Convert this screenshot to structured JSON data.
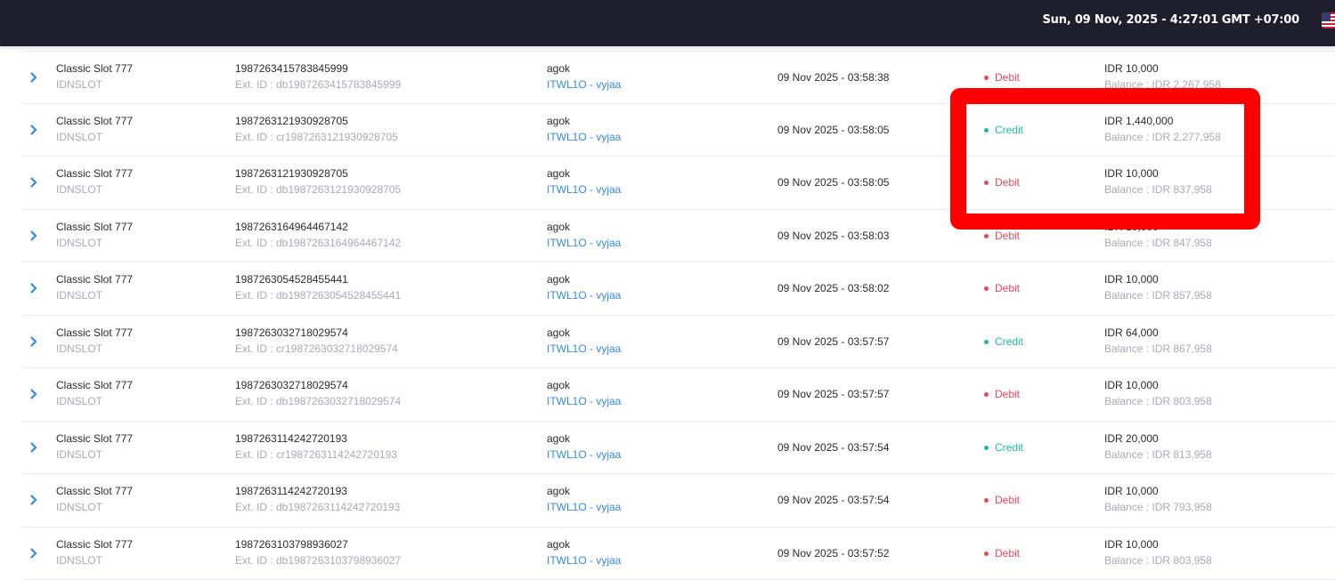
{
  "header": {
    "datetime": "Sun, 09 Nov, 2025 - 4:27:01",
    "timezone": "GMT +07:00",
    "language_flag_icon": "us-flag-icon"
  },
  "rows": [
    {
      "game": "Classic Slot 777",
      "provider": "IDNSLOT",
      "txid": "1987263415783845999",
      "extid": "Ext. ID : db1987263415783845999",
      "user": "agok",
      "agent": "ITWL1O - vyjaa",
      "date": "09 Nov 2025 - 03:58:38",
      "type": "Debit",
      "amount": "IDR 10,000",
      "balance": "Balance : IDR 2,267,958"
    },
    {
      "game": "Classic Slot 777",
      "provider": "IDNSLOT",
      "txid": "1987263121930928705",
      "extid": "Ext. ID : cr1987263121930928705",
      "user": "agok",
      "agent": "ITWL1O - vyjaa",
      "date": "09 Nov 2025 - 03:58:05",
      "type": "Credit",
      "amount": "IDR 1,440,000",
      "balance": "Balance : IDR 2,277,958"
    },
    {
      "game": "Classic Slot 777",
      "provider": "IDNSLOT",
      "txid": "1987263121930928705",
      "extid": "Ext. ID : db1987263121930928705",
      "user": "agok",
      "agent": "ITWL1O - vyjaa",
      "date": "09 Nov 2025 - 03:58:05",
      "type": "Debit",
      "amount": "IDR 10,000",
      "balance": "Balance : IDR 837,958"
    },
    {
      "game": "Classic Slot 777",
      "provider": "IDNSLOT",
      "txid": "1987263164964467142",
      "extid": "Ext. ID : db1987263164964467142",
      "user": "agok",
      "agent": "ITWL1O - vyjaa",
      "date": "09 Nov 2025 - 03:58:03",
      "type": "Debit",
      "amount": "IDR 10,000",
      "balance": "Balance : IDR 847,958"
    },
    {
      "game": "Classic Slot 777",
      "provider": "IDNSLOT",
      "txid": "1987263054528455441",
      "extid": "Ext. ID : db1987263054528455441",
      "user": "agok",
      "agent": "ITWL1O - vyjaa",
      "date": "09 Nov 2025 - 03:58:02",
      "type": "Debit",
      "amount": "IDR 10,000",
      "balance": "Balance : IDR 857,958"
    },
    {
      "game": "Classic Slot 777",
      "provider": "IDNSLOT",
      "txid": "1987263032718029574",
      "extid": "Ext. ID : cr1987263032718029574",
      "user": "agok",
      "agent": "ITWL1O - vyjaa",
      "date": "09 Nov 2025 - 03:57:57",
      "type": "Credit",
      "amount": "IDR 64,000",
      "balance": "Balance : IDR 867,958"
    },
    {
      "game": "Classic Slot 777",
      "provider": "IDNSLOT",
      "txid": "1987263032718029574",
      "extid": "Ext. ID : db1987263032718029574",
      "user": "agok",
      "agent": "ITWL1O - vyjaa",
      "date": "09 Nov 2025 - 03:57:57",
      "type": "Debit",
      "amount": "IDR 10,000",
      "balance": "Balance : IDR 803,958"
    },
    {
      "game": "Classic Slot 777",
      "provider": "IDNSLOT",
      "txid": "1987263114242720193",
      "extid": "Ext. ID : cr1987263114242720193",
      "user": "agok",
      "agent": "ITWL1O - vyjaa",
      "date": "09 Nov 2025 - 03:57:54",
      "type": "Credit",
      "amount": "IDR 20,000",
      "balance": "Balance : IDR 813,958"
    },
    {
      "game": "Classic Slot 777",
      "provider": "IDNSLOT",
      "txid": "1987263114242720193",
      "extid": "Ext. ID : db1987263114242720193",
      "user": "agok",
      "agent": "ITWL1O - vyjaa",
      "date": "09 Nov 2025 - 03:57:54",
      "type": "Debit",
      "amount": "IDR 10,000",
      "balance": "Balance : IDR 793,958"
    },
    {
      "game": "Classic Slot 777",
      "provider": "IDNSLOT",
      "txid": "1987263103798936027",
      "extid": "Ext. ID : db1987263103798936027",
      "user": "agok",
      "agent": "ITWL1O - vyjaa",
      "date": "09 Nov 2025 - 03:57:52",
      "type": "Debit",
      "amount": "IDR 10,000",
      "balance": "Balance : IDR 803,958"
    }
  ],
  "colors": {
    "debit": "#e24a5c",
    "credit": "#1bb8a8",
    "link": "#2f8be6",
    "highlight": "#ff0000",
    "topbar": "#1e1e2d"
  },
  "icons": {
    "expand": "chevron-right-icon",
    "status": "status-dot-icon"
  }
}
